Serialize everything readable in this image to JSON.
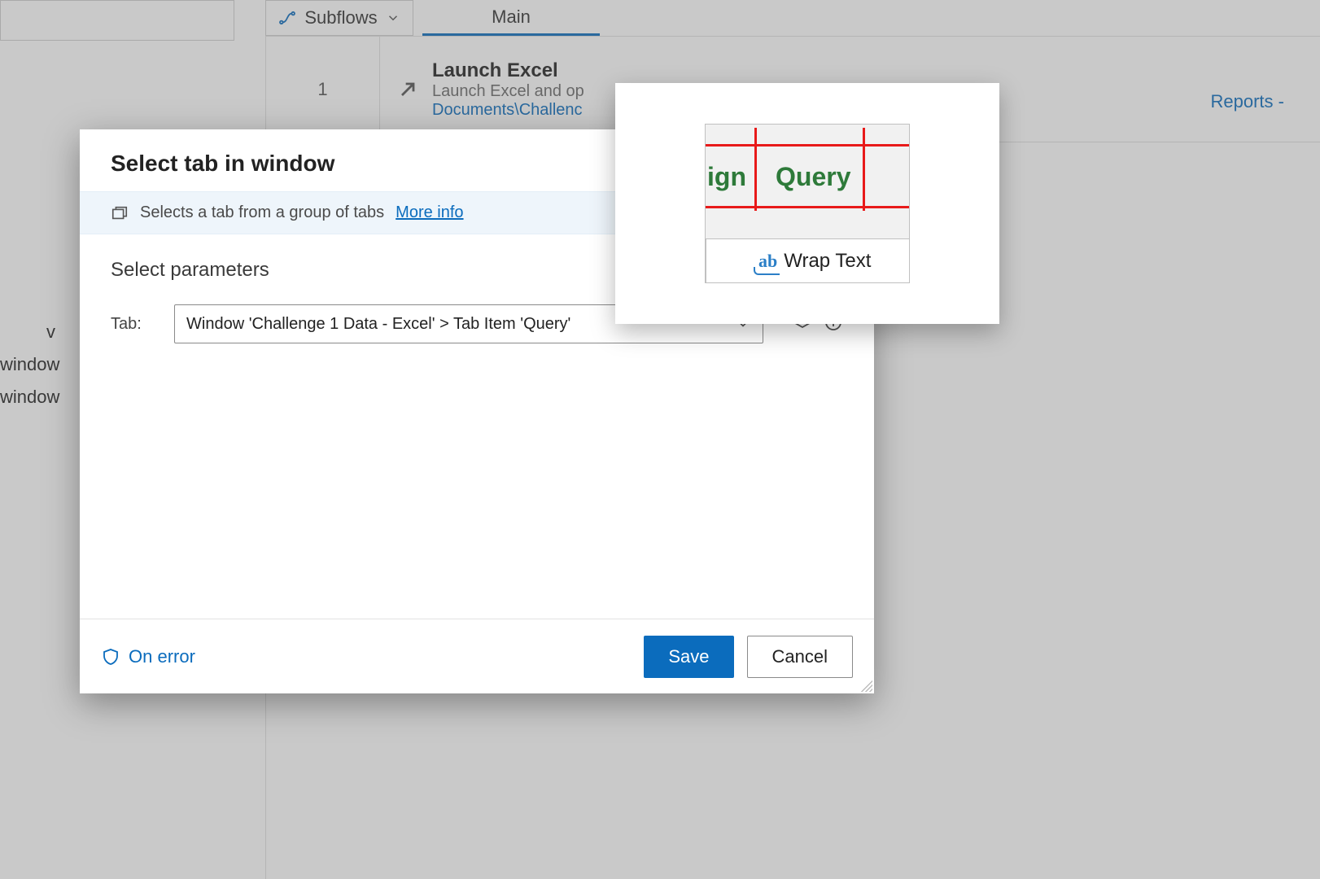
{
  "topbar": {
    "subflows_label": "Subflows",
    "main_tab_label": "Main"
  },
  "background": {
    "step_number": "1",
    "step_title": "Launch Excel",
    "step_subtitle": "Launch Excel and op",
    "step_path": "Documents\\Challenc",
    "right_link": "Reports -",
    "left_cut_lines": [
      "v",
      "window",
      "window"
    ]
  },
  "modal": {
    "title": "Select tab in window",
    "info_text": "Selects a tab from a group of tabs ",
    "info_link": "More info",
    "section_title": "Select parameters",
    "param_label": "Tab:",
    "combo_value": "Window 'Challenge 1 Data - Excel' > Tab Item 'Query'",
    "on_error": "On error",
    "save": "Save",
    "cancel": "Cancel"
  },
  "preview": {
    "left_fragment": "ign",
    "tab_text": "Query",
    "wrap_ab": "ab",
    "wrap_text": "Wrap Text"
  }
}
